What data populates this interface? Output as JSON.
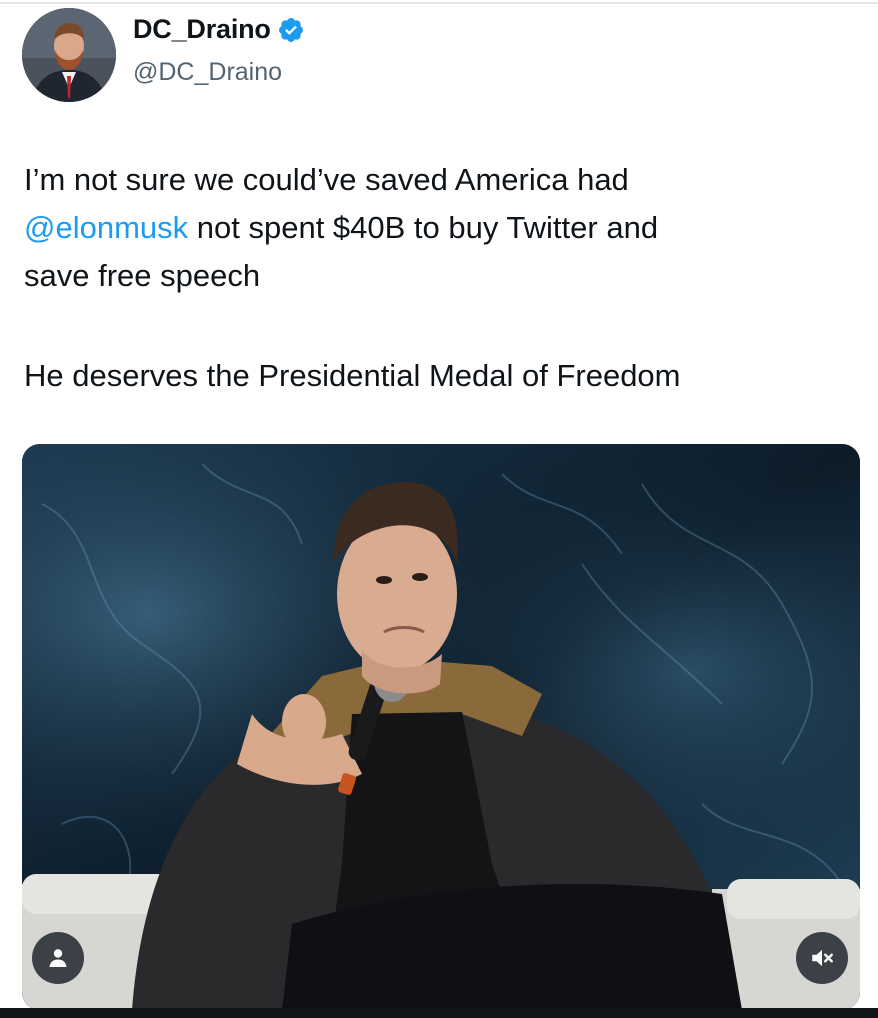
{
  "author": {
    "display_name": "DC_Draino",
    "handle": "@DC_Draino",
    "verified": true,
    "verified_color": "#1d9bf0"
  },
  "tweet": {
    "line1": "I’m not sure we could’ve saved America had",
    "mention": "@elonmusk",
    "line2_rest": " not spent $40B to buy Twitter and",
    "line3": "save free speech",
    "paragraph2": "He deserves the Presidential Medal of Freedom"
  },
  "media": {
    "type": "photo",
    "controls": [
      "person-icon",
      "muted-speaker-icon"
    ]
  },
  "colors": {
    "text": "#0f1419",
    "secondary": "#536471",
    "link": "#1d9bf0"
  }
}
